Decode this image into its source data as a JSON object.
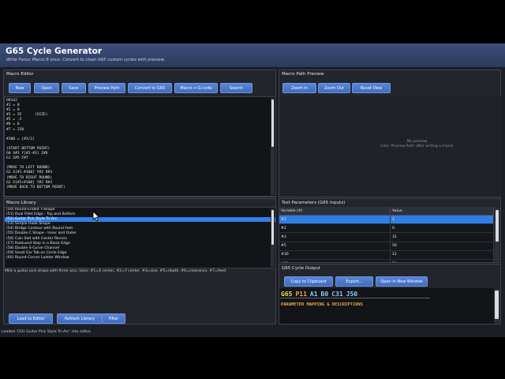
{
  "window": {
    "title": "G65 Cycle Generator",
    "subtitle": "Write Fanuc Macro B once. Convert to clean G65 custom cycles with preview."
  },
  "macro_editor": {
    "title": "Macro Editor",
    "buttons": {
      "new": "New",
      "open": "Open",
      "save": "Save",
      "preview_path": "Preview Path",
      "convert": "Convert to G65",
      "macro_gcode": "Macro ↔ G-code",
      "search": "Search"
    },
    "code": "O9142\n#1 = 0\n#2 = 0\n#3 = 35      (SIZE)\n#5 = -2\n#6 = 6\n#7 = 220\n\n#100 = [#3/2]\n\n(START BOTTOM POINT)\nG0 X#1 Y[#2-#3] Z#6\nG1 Z#5 F#7\n\n(MOVE TO LEFT ROUND)\nG2 X[#1-#100] Y#2 R#3\n(MOVE TO RIGHT ROUND)\nG2 X[#1+#100] Y#2 R#3\n(MOVE BACK TO BOTTOM POINT)"
  },
  "macro_library": {
    "title": "Macro Library",
    "items": [
      "(50) Round-Ended T-Shape",
      "(51) Dual Fillet Edge - Top and Bottom",
      "(52) Guitar Pick Style Tri-Arc",
      "(53) Simple Hook Shape",
      "(54) Bridge Contour with Round Feet",
      "(55) Double C Shape - Inner and Outer",
      "(56) Coin Slot with Center Recess",
      "(57) Radiused Step in a Block Edge",
      "(58) Double S-Curve Channel",
      "(59) Small Ear Tab on Circle Edge",
      "(60) Round-Corner Ladder Window"
    ],
    "selected_index": 2,
    "description": "Mills a guitar pick shape with three arcs. Uses: #1=X center, #2=Y center, #3=size, #5=depth, #6=clearance, #7=feed",
    "buttons": {
      "load": "Load to Editor",
      "refresh": "Refresh Library",
      "filter": "Filter"
    }
  },
  "path_preview": {
    "title": "Macro Path Preview",
    "buttons": {
      "zoom_in": "Zoom In",
      "zoom_out": "Zoom Out",
      "reset": "Reset View"
    },
    "empty_line1": "No preview.",
    "empty_line2": "Click 'Preview Path' after writing a macro."
  },
  "test_params": {
    "title": "Test Parameters (G65 Inputs)",
    "col_variable": "Variable (#)",
    "col_value": "Value",
    "rows": [
      {
        "var": "#1",
        "val": "1"
      },
      {
        "var": "#2",
        "val": "0"
      },
      {
        "var": "#3",
        "val": "31"
      },
      {
        "var": "#5",
        "val": "50"
      },
      {
        "var": "#30",
        "val": "12"
      },
      {
        "var": "#31",
        "val": "50"
      }
    ],
    "selected_index": 0
  },
  "g65_output": {
    "title": "G65 Cycle Output",
    "buttons": {
      "copy": "Copy to Clipboard",
      "export": "Export...",
      "open_window": "Open in New Window"
    },
    "tokens": [
      "G65",
      "P11",
      "A1",
      "B0",
      "C31",
      "J50"
    ],
    "heading": "PARAMETER MAPPING & DESCRIPTIONS"
  },
  "status": "Loaded '(52) Guitar Pick Style Tri-Arc' into editor.",
  "colors": {
    "accent": "#2f7fe6",
    "button": "#4a78cc",
    "output_yellow": "#f2e14b",
    "output_orange": "#f0a64a"
  }
}
